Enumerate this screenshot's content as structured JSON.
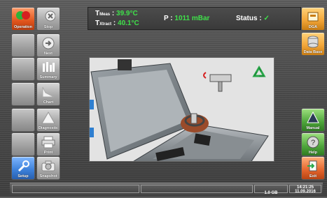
{
  "left_nav": {
    "operation": "Operation",
    "stop": "Stop",
    "next": "Next",
    "summary": "Summary",
    "chart": "Chart",
    "diagnostic": "Diagnostic",
    "print": "Print",
    "setup": "Setup",
    "snapshot": "Snapshot"
  },
  "header": {
    "t_meas_label": "T",
    "t_meas_sub": "Meas",
    "t_meas_value": "39.9°C",
    "t_xtract_label": "T",
    "t_xtract_sub": "Xtract",
    "t_xtract_value": "40.1°C",
    "pressure_label": "P :",
    "pressure_value": "1011 mBar",
    "status_label": "Status :",
    "status_check": "✓"
  },
  "right_nav": {
    "dga": "DGA",
    "database": "Data Base",
    "manual": "Manual",
    "help": "Help",
    "exit": "Exit"
  },
  "status_bar": {
    "disk": "1.0 GB",
    "time": "14:21:25",
    "date": "11.09.2016"
  },
  "colors": {
    "value_green": "#3fe04a",
    "operation_active": "#e0551c",
    "setup_active": "#3b7fd8"
  }
}
